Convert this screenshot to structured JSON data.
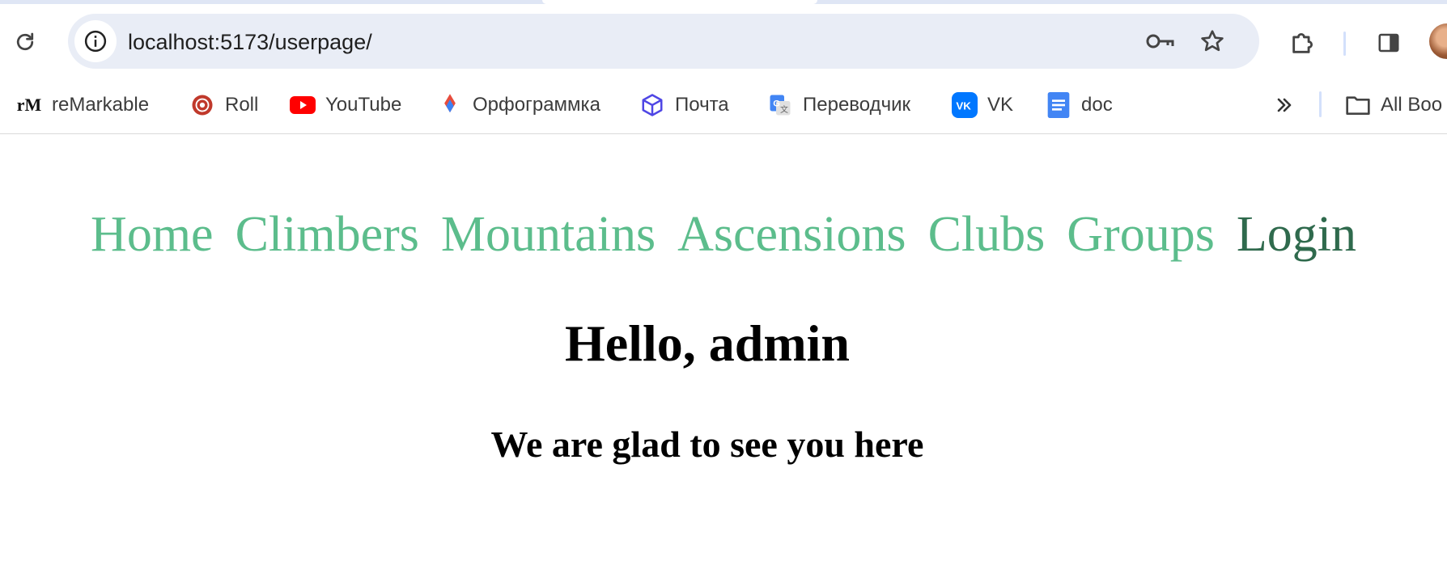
{
  "browser": {
    "url": "localhost:5173/userpage/",
    "bookmarks": [
      {
        "label": "reMarkable",
        "icon": "remarkable-icon"
      },
      {
        "label": "Roll",
        "icon": "roll-icon"
      },
      {
        "label": "YouTube",
        "icon": "youtube-icon"
      },
      {
        "label": "Орфограммка",
        "icon": "orfogrammka-icon"
      },
      {
        "label": "Почта",
        "icon": "mail-box-icon"
      },
      {
        "label": "Переводчик",
        "icon": "google-translate-icon"
      },
      {
        "label": "VK",
        "icon": "vk-icon"
      },
      {
        "label": "doc",
        "icon": "google-docs-icon"
      }
    ],
    "all_bookmarks_label": "All Boo"
  },
  "nav": {
    "items": [
      "Home",
      "Climbers",
      "Mountains",
      "Ascensions",
      "Clubs",
      "Groups"
    ],
    "login": "Login",
    "link_color": "#5cbd8c",
    "login_color": "#2f6a4d"
  },
  "main": {
    "greeting": "Hello, admin",
    "subtitle": "We are glad to see you here"
  }
}
